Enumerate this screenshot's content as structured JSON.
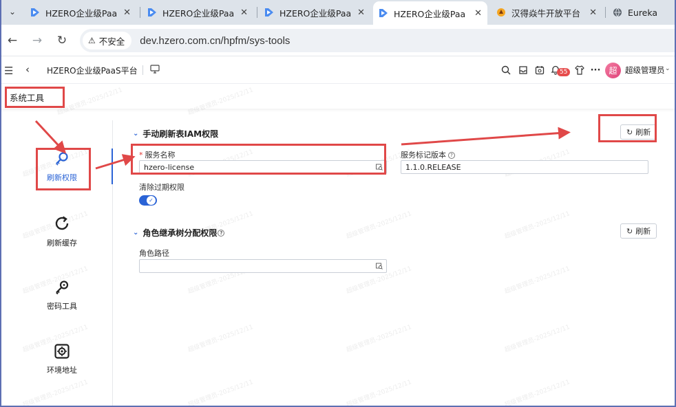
{
  "browser": {
    "tabs": [
      {
        "title": "HZERO企业级Paa",
        "icon": "hzero-favicon-icon",
        "active": false
      },
      {
        "title": "HZERO企业级Paa",
        "icon": "hzero-favicon-icon",
        "active": false
      },
      {
        "title": "HZERO企业级Paa",
        "icon": "hzero-favicon-icon",
        "active": false
      },
      {
        "title": "HZERO企业级Paa",
        "icon": "hzero-favicon-icon",
        "active": true
      },
      {
        "title": "汉得焱牛开放平台",
        "icon": "hand-favicon-icon",
        "active": false
      },
      {
        "title": "Eureka",
        "icon": "globe-icon",
        "active": false
      }
    ],
    "tab_close": "✕",
    "security_label": "不安全",
    "url": "dev.hzero.com.cn/hpfm/sys-tools"
  },
  "header": {
    "app_title": "HZERO企业级PaaS平台",
    "notification_count": "55",
    "avatar_text": "超",
    "user_name": "超级管理员"
  },
  "page_tab": {
    "label": "系统工具"
  },
  "menu": {
    "items": [
      {
        "label": "刷新权限",
        "icon": "search-key-icon",
        "active": true
      },
      {
        "label": "刷新缓存",
        "icon": "refresh-icon",
        "active": false
      },
      {
        "label": "密码工具",
        "icon": "key-icon",
        "active": false
      },
      {
        "label": "环境地址",
        "icon": "environment-icon",
        "active": false
      }
    ]
  },
  "section_iam": {
    "title": "手动刷新表IAM权限",
    "refresh_label": "刷新",
    "service_name_label": "服务名称",
    "service_name_value": "hzero-license",
    "service_version_label": "服务标记版本",
    "service_version_value": "1.1.0.RELEASE",
    "clear_expired_label": "清除过期权限",
    "clear_expired_on": true
  },
  "section_role": {
    "title": "角色继承树分配权限",
    "refresh_label": "刷新",
    "role_path_label": "角色路径",
    "role_path_value": ""
  },
  "watermark": "超级管理员-2025/12/11",
  "colors": {
    "primary": "#2a63d6",
    "annotation_red": "#e04848",
    "badge_red": "#e64c4c"
  }
}
